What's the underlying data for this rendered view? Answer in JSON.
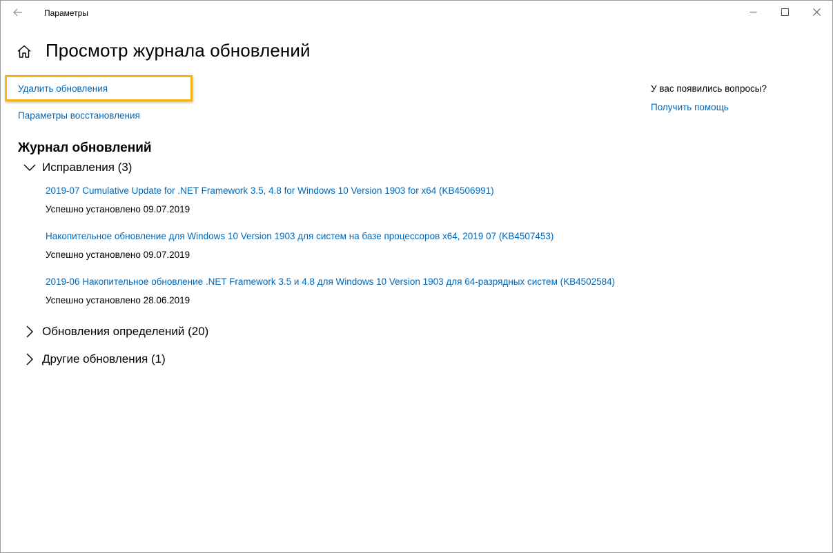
{
  "window": {
    "title": "Параметры"
  },
  "page": {
    "title": "Просмотр журнала обновлений"
  },
  "links": {
    "uninstall": "Удалить обновления",
    "recovery": "Параметры восстановления"
  },
  "help": {
    "question": "У вас появились вопросы?",
    "get_help": "Получить помощь"
  },
  "history": {
    "title": "Журнал обновлений",
    "groups": [
      {
        "label": "Исправления (3)",
        "expanded": true,
        "items": [
          {
            "name": "2019-07 Cumulative Update for .NET Framework 3.5, 4.8 for Windows 10 Version 1903 for x64 (KB4506991)",
            "status": "Успешно установлено 09.07.2019"
          },
          {
            "name": "Накопительное обновление для Windows 10 Version 1903 для систем на базе процессоров x64, 2019 07 (KB4507453)",
            "status": "Успешно установлено 09.07.2019"
          },
          {
            "name": "2019-06 Накопительное обновление .NET Framework 3.5 и 4.8 для Windows 10 Version 1903 для 64-разрядных систем (KB4502584)",
            "status": "Успешно установлено 28.06.2019"
          }
        ]
      },
      {
        "label": "Обновления определений (20)",
        "expanded": false
      },
      {
        "label": "Другие обновления (1)",
        "expanded": false
      }
    ]
  },
  "colors": {
    "link": "#0067b8",
    "highlight": "#f5b70f"
  }
}
